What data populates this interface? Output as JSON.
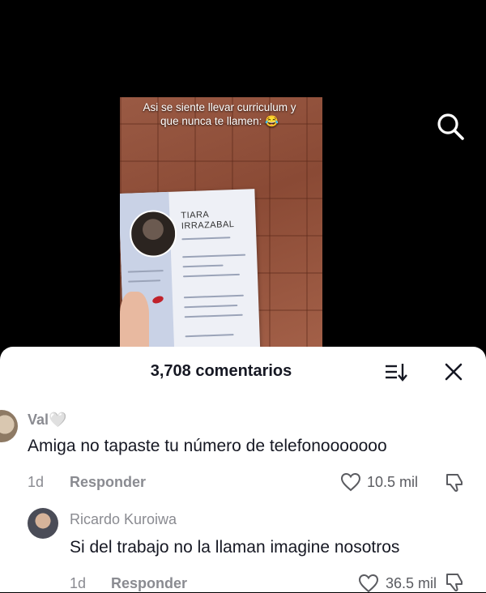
{
  "video": {
    "caption": "Asi se siente llevar curriculum y que nunca te llamen: 😂",
    "resume_name_line1": "TIARA",
    "resume_name_line2": "IRRAZABAL"
  },
  "comments_panel": {
    "title": "3,708 comentarios",
    "comments": [
      {
        "username": "Val🤍",
        "text": "Amiga no tapaste tu número de telefonooooooo",
        "time": "1d",
        "reply_label": "Responder",
        "likes": "10.5 mil"
      },
      {
        "username": "Ricardo Kuroiwa",
        "text": "Si del trabajo no la llaman imagine nosotros",
        "time": "1d",
        "reply_label": "Responder",
        "likes": "36.5 mil"
      }
    ]
  },
  "icons": [
    "search-icon",
    "sort-icon",
    "close-icon",
    "heart-icon",
    "dislike-icon"
  ]
}
